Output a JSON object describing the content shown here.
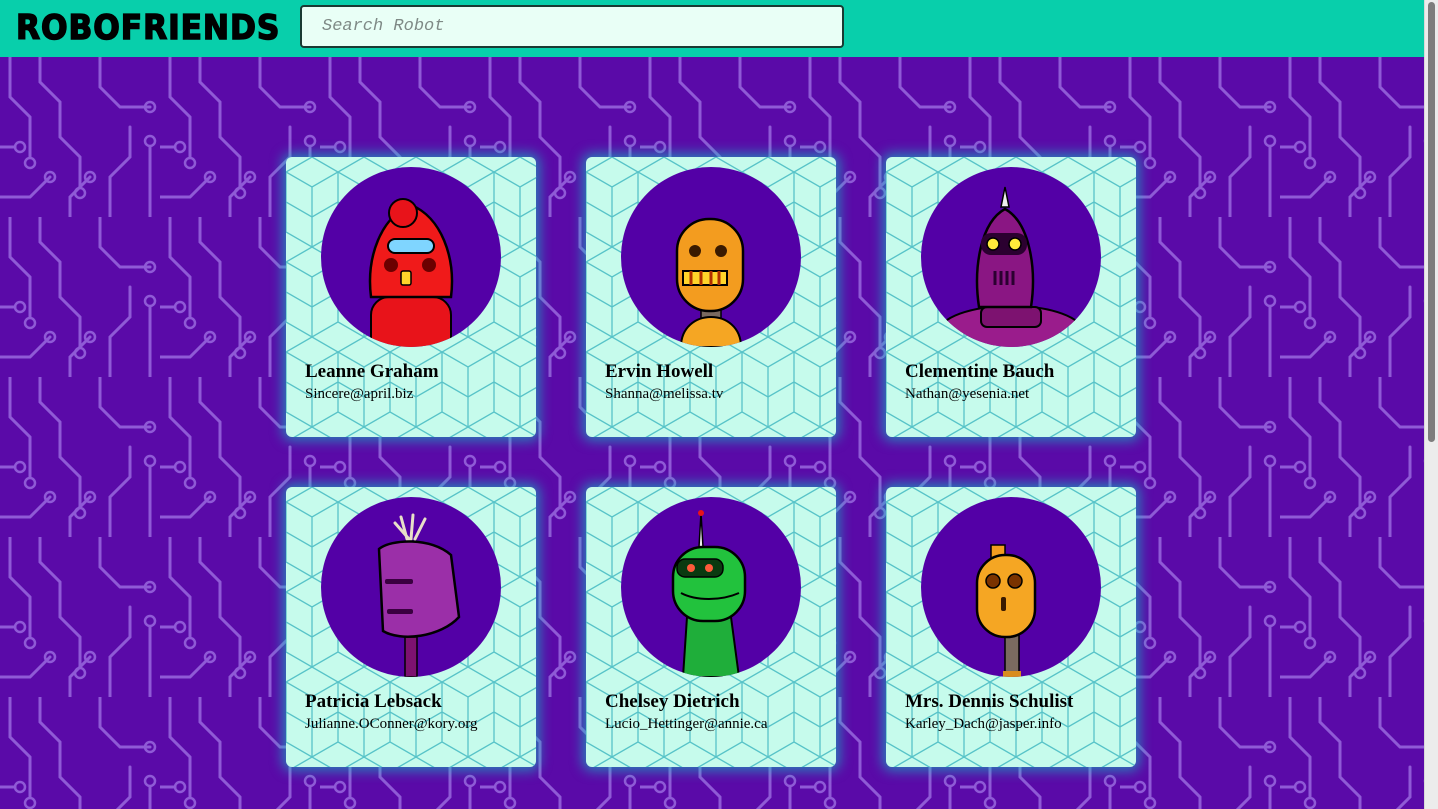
{
  "app": {
    "title": "ROBOFRIENDS"
  },
  "search": {
    "placeholder": "Search Robot",
    "value": ""
  },
  "colors": {
    "header": "#08cfab",
    "background": "#5a0aa8",
    "card": "#c6fbec",
    "avatar": "#5300a6"
  },
  "robots": [
    {
      "name": "Leanne Graham",
      "email": "Sincere@april.biz",
      "robot_color": "red"
    },
    {
      "name": "Ervin Howell",
      "email": "Shanna@melissa.tv",
      "robot_color": "orange"
    },
    {
      "name": "Clementine Bauch",
      "email": "Nathan@yesenia.net",
      "robot_color": "magenta"
    },
    {
      "name": "Patricia Lebsack",
      "email": "Julianne.OConner@kory.org",
      "robot_color": "purple"
    },
    {
      "name": "Chelsey Dietrich",
      "email": "Lucio_Hettinger@annie.ca",
      "robot_color": "green"
    },
    {
      "name": "Mrs. Dennis Schulist",
      "email": "Karley_Dach@jasper.info",
      "robot_color": "orange"
    }
  ]
}
